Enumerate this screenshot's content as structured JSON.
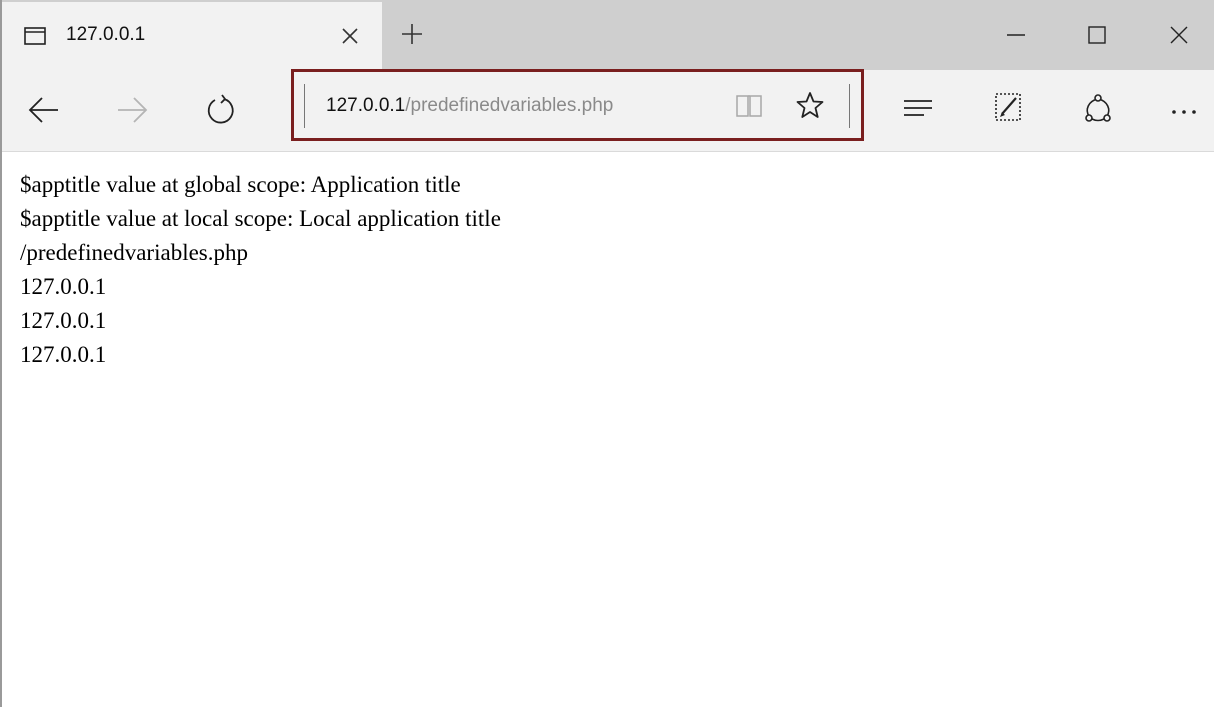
{
  "tab": {
    "title": "127.0.0.1",
    "icon": "page-icon"
  },
  "address_bar": {
    "host": "127.0.0.1",
    "path": "/predefinedvariables.php",
    "highlight_color": "#7a1f1f"
  },
  "toolbar": {
    "icons": [
      "back-arrow-icon",
      "forward-arrow-icon",
      "refresh-icon",
      "reading-view-icon",
      "favorite-star-icon",
      "hub-icon",
      "web-note-icon",
      "share-icon",
      "more-icon"
    ]
  },
  "window_controls": [
    "minimize-icon",
    "maximize-icon",
    "close-icon"
  ],
  "page": {
    "lines": [
      "$apptitle value at global scope: Application title",
      "$apptitle value at local scope: Local application title",
      "/predefinedvariables.php",
      "127.0.0.1",
      "127.0.0.1",
      "127.0.0.1"
    ]
  }
}
